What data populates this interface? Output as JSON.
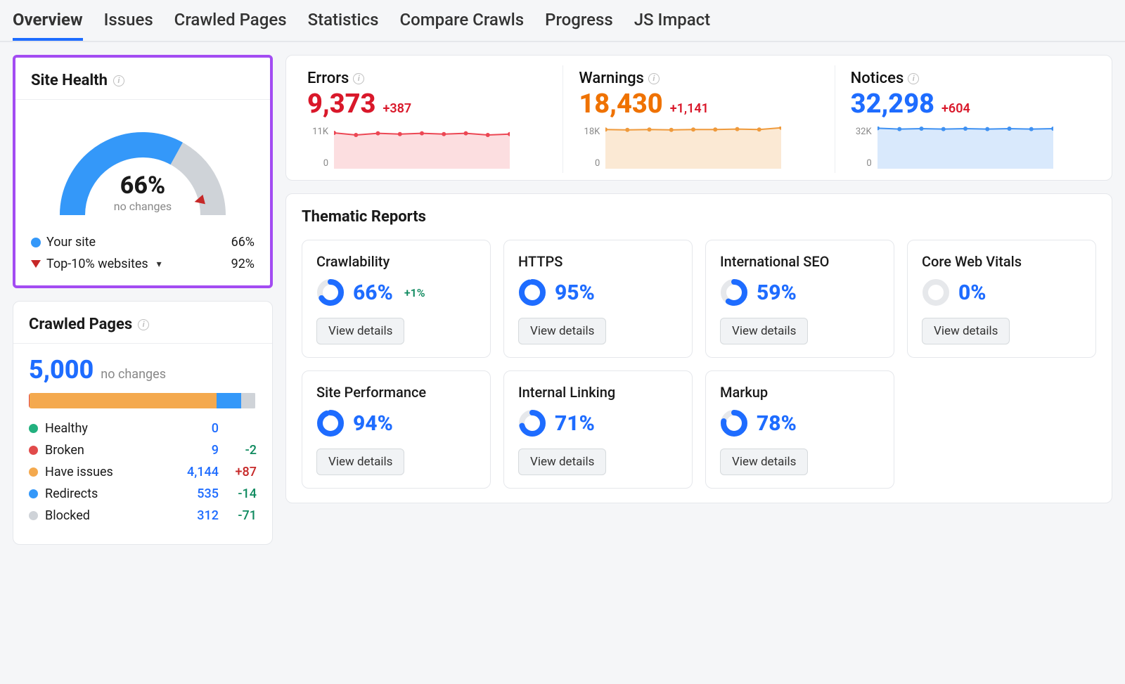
{
  "tabs": [
    "Overview",
    "Issues",
    "Crawled Pages",
    "Statistics",
    "Compare Crawls",
    "Progress",
    "JS Impact"
  ],
  "active_tab": 0,
  "site_health": {
    "title": "Site Health",
    "gauge_pct": "66%",
    "gauge_sub": "no changes",
    "your_site_label": "Your site",
    "your_site_pct": "66%",
    "top10_label": "Top-10% websites",
    "top10_pct": "92%"
  },
  "crawled_pages": {
    "title": "Crawled Pages",
    "total": "5,000",
    "total_sub": "no changes",
    "segments": [
      {
        "label": "Broken",
        "pct": 0.4,
        "color": "#e14b4b"
      },
      {
        "label": "Have issues",
        "pct": 82,
        "color": "#f4a94e"
      },
      {
        "label": "Redirects",
        "pct": 10.7,
        "color": "#3498f9"
      },
      {
        "label": "Blocked",
        "pct": 6.2,
        "color": "#cfd3d8"
      }
    ],
    "rows": [
      {
        "color": "#22b07e",
        "label": "Healthy",
        "value": "0",
        "delta": "",
        "delta_cls": ""
      },
      {
        "color": "#e14b4b",
        "label": "Broken",
        "value": "9",
        "delta": "-2",
        "delta_cls": "delta-green"
      },
      {
        "color": "#f4a94e",
        "label": "Have issues",
        "value": "4,144",
        "delta": "+87",
        "delta_cls": "delta-red"
      },
      {
        "color": "#3498f9",
        "label": "Redirects",
        "value": "535",
        "delta": "-14",
        "delta_cls": "delta-green"
      },
      {
        "color": "#cfd3d8",
        "label": "Blocked",
        "value": "312",
        "delta": "-71",
        "delta_cls": "delta-green"
      }
    ]
  },
  "kpis": [
    {
      "title": "Errors",
      "num": "9,373",
      "delta": "+387",
      "cls": "kpi-red",
      "ymax": "11K",
      "ymin": "0",
      "color": "#ec4754",
      "fill": "rgba(236,71,84,0.18)",
      "pts": [
        0.85,
        0.8,
        0.84,
        0.82,
        0.84,
        0.82,
        0.84,
        0.8,
        0.82
      ]
    },
    {
      "title": "Warnings",
      "num": "18,430",
      "delta": "+1,141",
      "cls": "kpi-orange",
      "ymax": "18K",
      "ymin": "0",
      "color": "#ef9a3c",
      "fill": "rgba(239,154,60,0.22)",
      "pts": [
        0.93,
        0.92,
        0.93,
        0.92,
        0.93,
        0.93,
        0.94,
        0.93,
        0.97
      ]
    },
    {
      "title": "Notices",
      "num": "32,298",
      "delta": "+604",
      "cls": "kpi-blue",
      "ymax": "32K",
      "ymin": "0",
      "color": "#3f91f2",
      "fill": "rgba(63,145,242,0.2)",
      "pts": [
        0.96,
        0.94,
        0.95,
        0.94,
        0.95,
        0.94,
        0.95,
        0.94,
        0.95
      ]
    }
  ],
  "thematic": {
    "title": "Thematic Reports",
    "view_label": "View details",
    "cards": [
      {
        "title": "Crawlability",
        "pct": "66%",
        "p": 66,
        "delta": "+1%"
      },
      {
        "title": "HTTPS",
        "pct": "95%",
        "p": 95,
        "delta": ""
      },
      {
        "title": "International SEO",
        "pct": "59%",
        "p": 59,
        "delta": ""
      },
      {
        "title": "Core Web Vitals",
        "pct": "0%",
        "p": 0,
        "delta": "",
        "gray": true
      },
      {
        "title": "Site Performance",
        "pct": "94%",
        "p": 94,
        "delta": ""
      },
      {
        "title": "Internal Linking",
        "pct": "71%",
        "p": 71,
        "delta": ""
      },
      {
        "title": "Markup",
        "pct": "78%",
        "p": 78,
        "delta": ""
      }
    ]
  },
  "chart_data": {
    "site_health_gauge": {
      "type": "gauge",
      "value": 66,
      "max": 100
    },
    "kpi_sparklines": [
      {
        "type": "area",
        "title": "Errors",
        "ylim": [
          0,
          11000
        ],
        "values": [
          9350,
          8800,
          9240,
          9020,
          9240,
          9020,
          9240,
          8800,
          9020
        ]
      },
      {
        "type": "area",
        "title": "Warnings",
        "ylim": [
          0,
          18000
        ],
        "values": [
          16740,
          16560,
          16740,
          16560,
          16740,
          16740,
          16920,
          16740,
          17460
        ]
      },
      {
        "type": "area",
        "title": "Notices",
        "ylim": [
          0,
          32000
        ],
        "values": [
          30720,
          30080,
          30400,
          30080,
          30400,
          30080,
          30400,
          30080,
          30400
        ]
      }
    ],
    "crawled_pages_bar": {
      "type": "bar",
      "unit": "pages",
      "total": 5000,
      "series": [
        {
          "name": "Broken",
          "value": 9
        },
        {
          "name": "Have issues",
          "value": 4144
        },
        {
          "name": "Redirects",
          "value": 535
        },
        {
          "name": "Blocked",
          "value": 312
        },
        {
          "name": "Healthy",
          "value": 0
        }
      ]
    }
  }
}
